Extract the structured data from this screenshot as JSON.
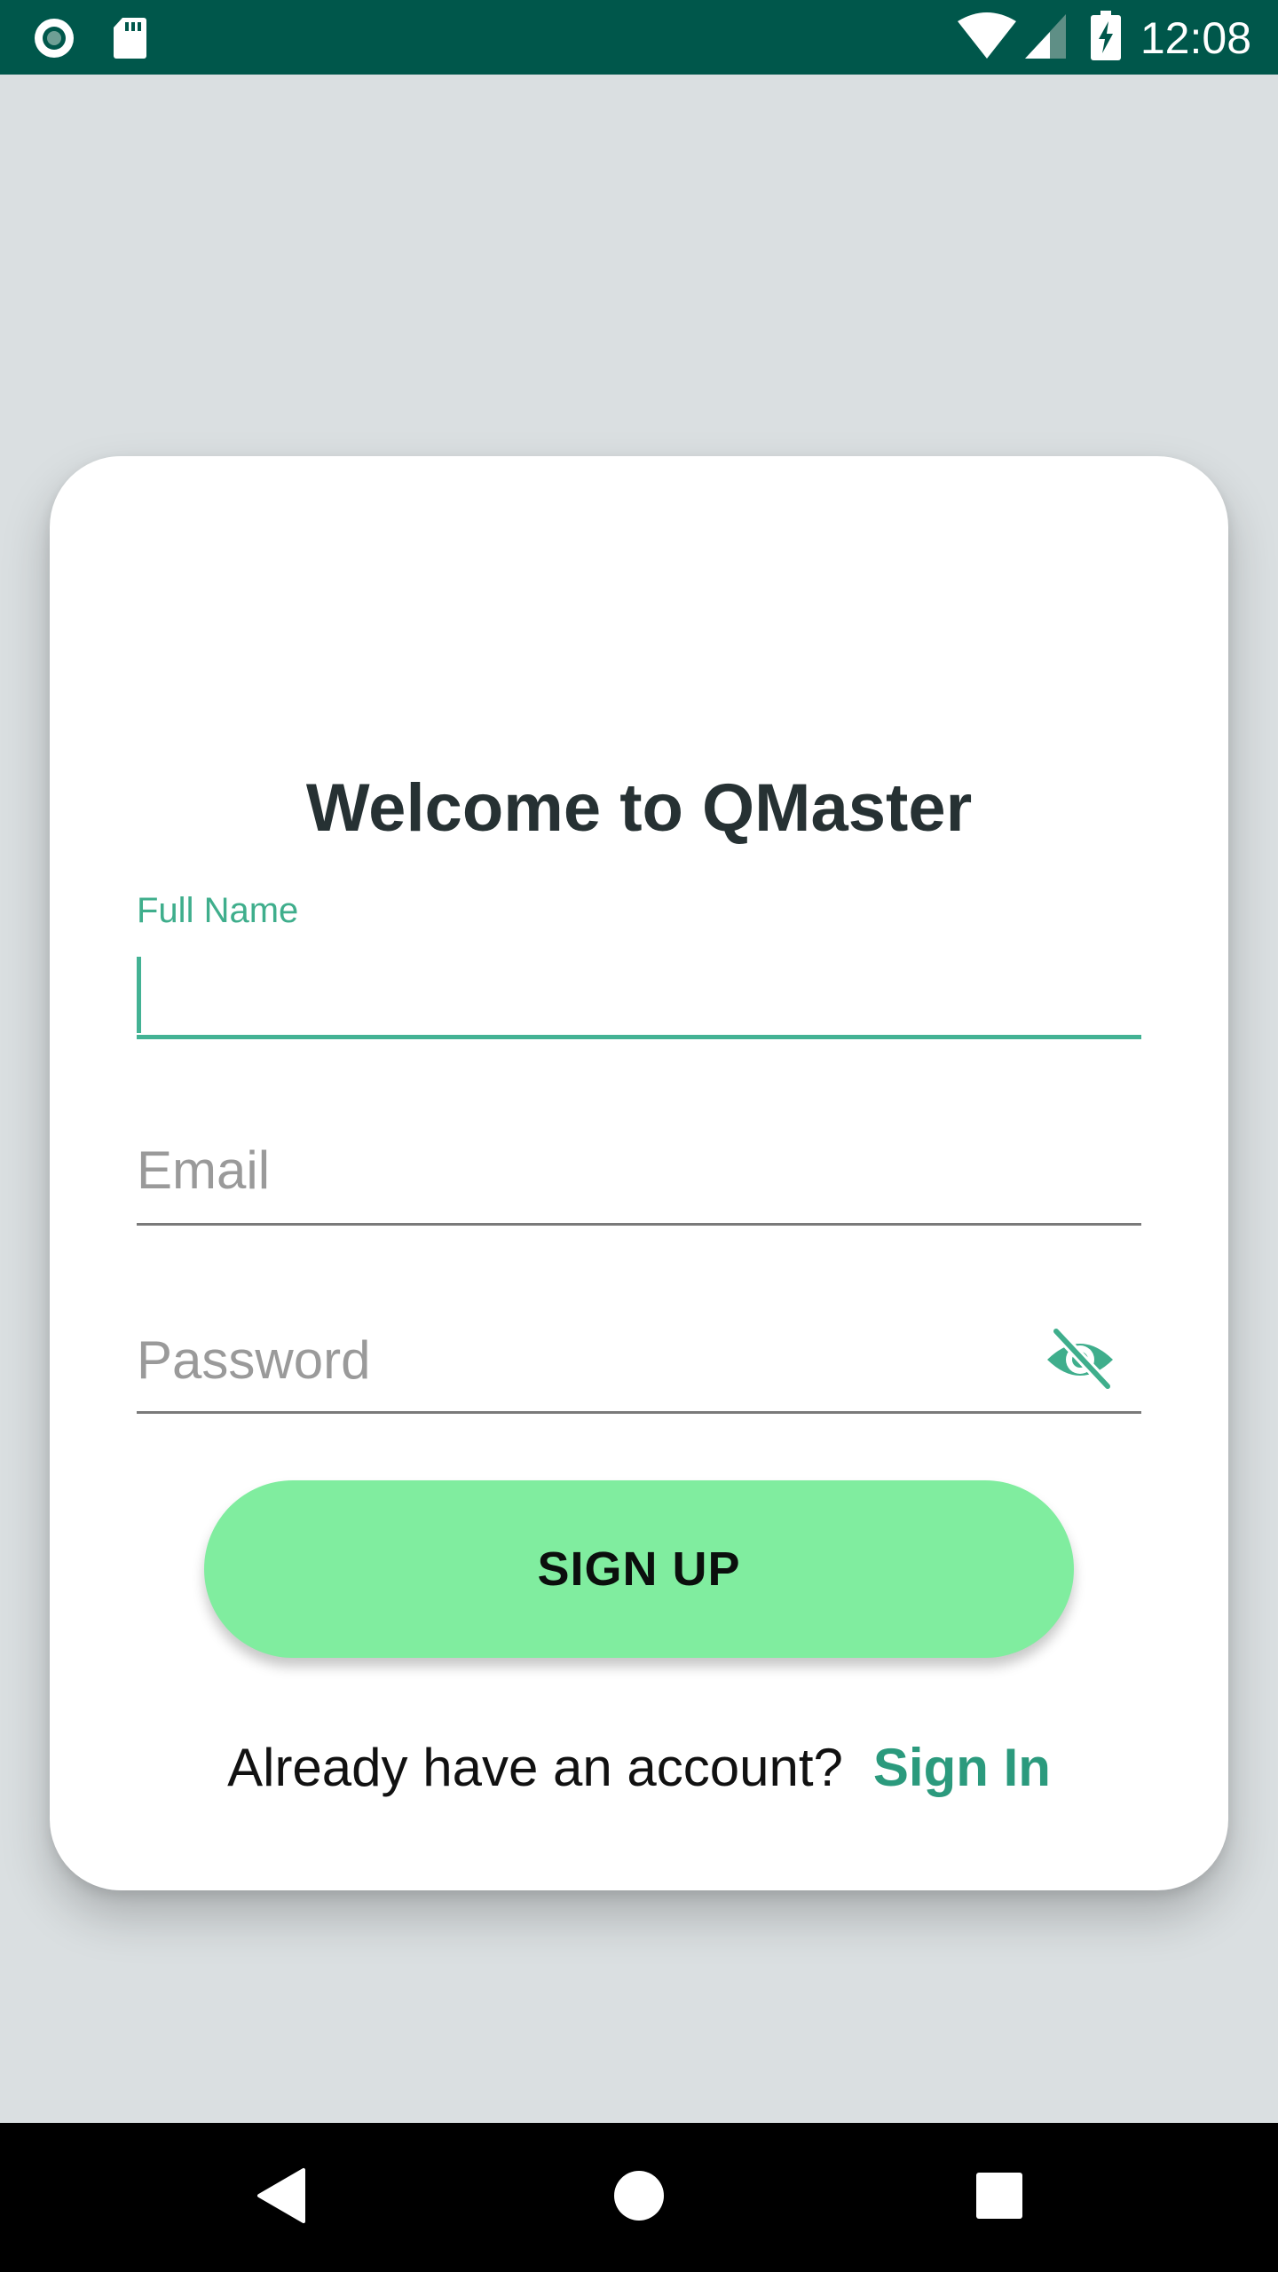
{
  "status_bar": {
    "time": "12:08",
    "icons": [
      "record-icon",
      "sd-card-icon",
      "wifi-icon",
      "signal-icon",
      "battery-charging-icon"
    ]
  },
  "card": {
    "title": "Welcome to QMaster",
    "fields": {
      "full_name": {
        "label": "Full Name",
        "value": ""
      },
      "email": {
        "placeholder": "Email",
        "value": ""
      },
      "password": {
        "placeholder": "Password",
        "value": "",
        "toggle_icon": "eye-off-icon"
      }
    },
    "signup_label": "SIGN UP",
    "account_prompt": "Already have an account?",
    "signin_label": "Sign In"
  },
  "navigation": {
    "buttons": [
      "back-icon",
      "home-icon",
      "recents-icon"
    ]
  },
  "colors": {
    "status_bar": "#00574b",
    "accent": "#43b294",
    "button": "#80ed9f",
    "link": "#2b9a7d",
    "background": "#dadfe1"
  }
}
